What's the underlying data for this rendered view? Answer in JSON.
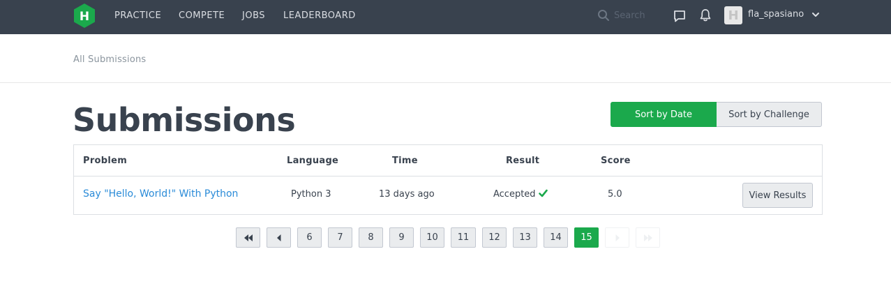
{
  "brand": {
    "logo_letter": "H",
    "logo_color": "#1ba94c"
  },
  "nav": {
    "items": [
      {
        "label": "PRACTICE"
      },
      {
        "label": "COMPETE"
      },
      {
        "label": "JOBS"
      },
      {
        "label": "LEADERBOARD"
      }
    ],
    "search_placeholder": "Search",
    "username": "fla_spasiano",
    "avatar_letter": "H"
  },
  "breadcrumb": {
    "label": "All Submissions"
  },
  "page": {
    "title": "Submissions"
  },
  "sort": {
    "date_label": "Sort by Date",
    "challenge_label": "Sort by Challenge",
    "active": "date"
  },
  "table": {
    "columns": [
      "Problem",
      "Language",
      "Time",
      "Result",
      "Score"
    ],
    "rows": [
      {
        "problem": "Say \"Hello, World!\" With Python",
        "language": "Python 3",
        "time": "13 days ago",
        "result": "Accepted",
        "score": "5.0",
        "action": "View Results"
      }
    ]
  },
  "pagination": {
    "pages": [
      "6",
      "7",
      "8",
      "9",
      "10",
      "11",
      "12",
      "13",
      "14",
      "15"
    ],
    "current": "15"
  },
  "colors": {
    "accent": "#1ba94c",
    "nav_bg": "#39424e",
    "link": "#2a8bd8",
    "text": "#39424e"
  }
}
